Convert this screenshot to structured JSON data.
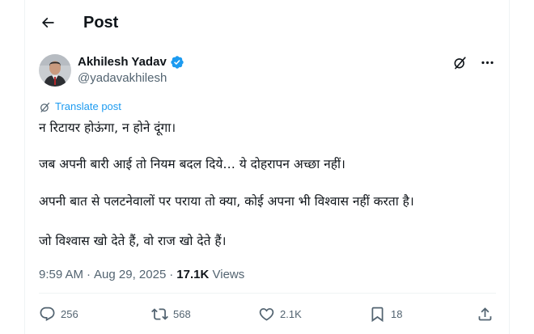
{
  "header": {
    "title": "Post"
  },
  "author": {
    "display_name": "Akhilesh Yadav",
    "handle": "@yadavakhilesh"
  },
  "translate": {
    "label": "Translate post"
  },
  "post": {
    "paragraphs": [
      "न रिटायर होऊंगा, न होने दूंगा।",
      "जब अपनी बारी आई तो नियम बदल दिये… ये दोहरापन अच्छा नहीं।",
      "अपनी बात से पलटनेवालों पर पराया तो क्या, कोई अपना भी विश्वास नहीं करता है।",
      "जो विश्वास खो देते हैं, वो राज खो देते हैं।"
    ]
  },
  "meta": {
    "time": "9:59 AM",
    "separator": "·",
    "date": "Aug 29, 2025",
    "views_count": "17.1K",
    "views_label": "Views"
  },
  "actions": {
    "replies": "256",
    "reposts": "568",
    "likes": "2.1K",
    "bookmarks": "18"
  },
  "colors": {
    "accent": "#1d9bf0",
    "text_primary": "#0f1419",
    "text_secondary": "#536471",
    "border": "#eff3f4"
  },
  "icons": {
    "back": "arrow-left-icon",
    "verified": "verified-badge-icon",
    "grok": "grok-icon",
    "more": "more-horizontal-icon",
    "translate": "translate-icon",
    "reply": "reply-icon",
    "repost": "repost-icon",
    "like": "heart-icon",
    "bookmark": "bookmark-icon",
    "share": "share-icon"
  }
}
